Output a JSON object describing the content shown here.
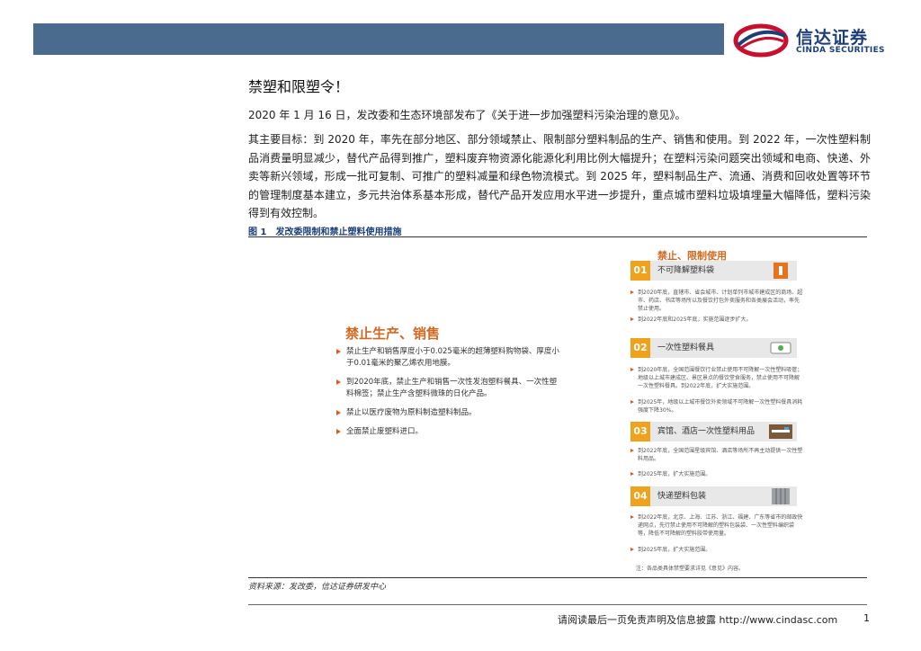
{
  "header": {
    "logo_cn": "信达证券",
    "logo_en": "CINDA SECURITIES",
    "colors": {
      "band": "#4a6a8e",
      "brand": "#1c3f7a",
      "accent": "#d2691e",
      "badge": "#f0a21c"
    }
  },
  "article": {
    "title": "禁塑和限塑令！",
    "para1": "2020 年 1 月 16 日，发改委和生态环境部发布了《关于进一步加强塑料污染治理的意见》。",
    "para2": "其主要目标：到 2020 年，率先在部分地区、部分领域禁止、限制部分塑料制品的生产、销售和使用。到 2022 年，一次性塑料制品消费量明显减少，替代产品得到推广，塑料废弃物资源化能源化利用比例大幅提升；在塑料污染问题突出领域和电商、快递、外卖等新兴领域，形成一批可复制、可推广的塑料减量和绿色物流模式。到 2025 年，塑料制品生产、流通、消费和回收处置等环节的管理制度基本建立，多元共治体系基本形成，替代产品开发应用水平进一步提升，重点城市塑料垃圾填埋量大幅降低，塑料污染得到有效控制。"
  },
  "figure": {
    "caption": "图 1　发改委限制和禁止塑料使用措施",
    "left_title": "禁止生产、销售",
    "left_items": [
      "禁止生产和销售厚度小于0.025毫米的超薄塑料购物袋、厚度小于0.01毫米的聚乙烯农用地膜。",
      "到2020年底，禁止生产和销售一次性发泡塑料餐具、一次性塑料棉签；禁止生产含塑料微珠的日化产品。",
      "禁止以医疗废物为原料制造塑料制品。",
      "全面禁止废塑料进口。"
    ],
    "right_title": "禁止、限制使用",
    "sections": [
      {
        "num": "01",
        "label": "不可降解塑料袋",
        "icon": "shopping-bag-icon",
        "items": [
          "到2020年底，直辖市、省会城市、计划单列市城市建成区的商场、超市、药店、书店等场所以及餐饮打包外卖服务和各类展会活动，率先禁止使用。",
          "到2022年底和2025年底，实施范围逐步扩大。"
        ]
      },
      {
        "num": "02",
        "label": "一次性塑料餐具",
        "icon": "tableware-icon",
        "items": [
          "到2020年底，全国范围餐饮行业禁止使用不可降解一次性塑料吸管；地级以上城市建成区、景区景点的餐饮堂食服务，禁止使用不可降解一次性塑料餐具。到2022年底，扩大实施范围。",
          "到2025年，地级以上城市餐饮外卖领域不可降解一次性塑料餐具消耗强度下降30%。"
        ]
      },
      {
        "num": "03",
        "label": "宾馆、酒店一次性塑料用品",
        "icon": "toothbrush-icon",
        "items": [
          "到2022年底，全国范围星级宾馆、酒店等场所不再主动提供一次性塑料用品。",
          "到2025年底，扩大实施范围。"
        ]
      },
      {
        "num": "04",
        "label": "快递塑料包装",
        "icon": "package-icon",
        "items": [
          "到2022年底，北京、上海、江苏、浙江、福建、广东等省市的邮政快递网点，先行禁止使用不可降解的塑料包装袋、一次性塑料编织袋等，降低不可降解的塑料胶带使用量。",
          "到2025年底，扩大实施范围。"
        ]
      }
    ],
    "note": "注：各品类具体禁塑要求详见《意见》内容。"
  },
  "source": "资料来源：发改委，信达证券研发中心",
  "footer": {
    "text": "请阅读最后一页免责声明及信息披露 http://www.cindasc.com",
    "page": "1"
  }
}
